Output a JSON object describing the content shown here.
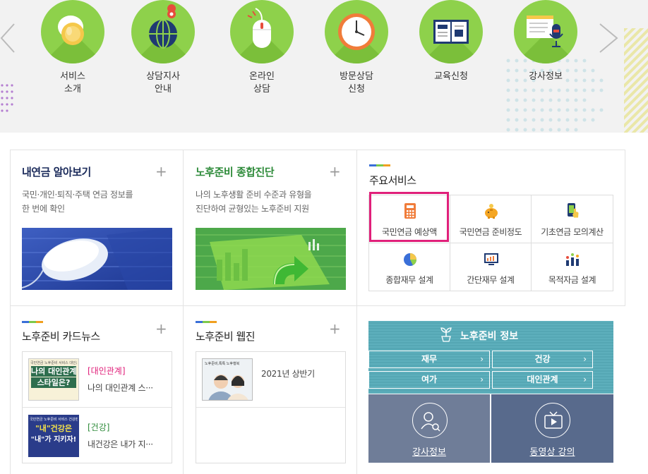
{
  "quick_menu": [
    {
      "label1": "서비스",
      "label2": "소개",
      "icon": "coin-icon"
    },
    {
      "label1": "상담지사",
      "label2": "안내",
      "icon": "globe-location-icon"
    },
    {
      "label1": "온라인",
      "label2": "상담",
      "icon": "mouse-icon"
    },
    {
      "label1": "방문상담",
      "label2": "신청",
      "icon": "clock-icon"
    },
    {
      "label1": "교육신청",
      "label2": "",
      "icon": "book-icon"
    },
    {
      "label1": "강사정보",
      "label2": "",
      "icon": "microphone-board-icon"
    }
  ],
  "pension_card": {
    "title": "내연금 알아보기",
    "desc1": "국민·개인·퇴직·주택 연금 정보를",
    "desc2": "한 번에 확인",
    "plus": "+"
  },
  "retire_card": {
    "title": "노후준비 종합진단",
    "desc1": "나의 노후생활 준비 수준과 유형을",
    "desc2": "진단하여 균형있는 노후준비 지원",
    "plus": "+"
  },
  "main_services": {
    "title": "주요서비스",
    "items": [
      {
        "label": "국민연금 예상액",
        "icon": "calculator-icon"
      },
      {
        "label": "국민연금 준비정도",
        "icon": "piggy-bank-icon"
      },
      {
        "label": "기초연금 모의계산",
        "icon": "phone-touch-icon"
      },
      {
        "label": "종합재무 설계",
        "icon": "pie-chart-icon"
      },
      {
        "label": "간단재무 설계",
        "icon": "monitor-chart-icon"
      },
      {
        "label": "목적자금 설계",
        "icon": "people-chart-icon"
      }
    ]
  },
  "cardnews": {
    "title": "노후준비 카드뉴스",
    "plus": "+",
    "items": [
      {
        "tag": "[대인관계]",
        "text": "나의 대인관계 스···",
        "thumb_line1": "국민연금 노후준비 서비스 대인관계",
        "thumb_big1": "나의 대인관계",
        "thumb_big2": "스타일은?",
        "tag_color": "#e0207a"
      },
      {
        "tag": "[건강]",
        "text": "내건강은 내가 지···",
        "thumb_line1": "국민연금 노후준비 서비스 건강편",
        "thumb_big1": "\"내\"건강은",
        "thumb_big2": "\"내\"가 지키자!",
        "tag_color": "#2e8b3a"
      }
    ]
  },
  "webzine": {
    "title": "노후준비 웹진",
    "plus": "+",
    "item": "2021년 상반기",
    "thumb_text": "노후준비,톡톡 노후행복"
  },
  "info": {
    "title": "노후준비 정보",
    "buttons": [
      "재무",
      "건강",
      "여가",
      "대인관계"
    ],
    "chev": "›",
    "bottom": [
      {
        "label": "강사정보"
      },
      {
        "label": "동영상 강의"
      }
    ]
  }
}
